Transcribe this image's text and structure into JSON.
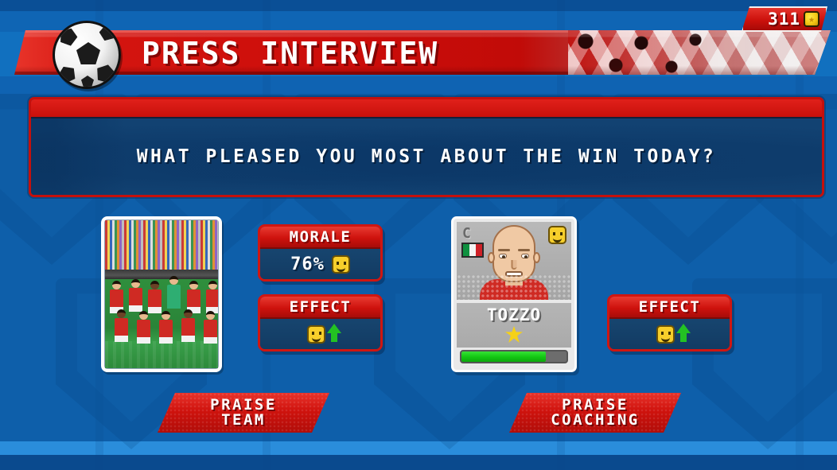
{
  "header": {
    "title": "PRESS INTERVIEW",
    "ball_icon": "soccer-ball-icon"
  },
  "currency": {
    "amount": "311",
    "icon": "coin-icon"
  },
  "question": {
    "text": "WHAT PLEASED YOU MOST ABOUT THE WIN TODAY?"
  },
  "team_option": {
    "photo_alt": "team-squad-photo",
    "morale": {
      "label": "MORALE",
      "value": "76%",
      "mood_icon": "smiley-face-icon"
    },
    "effect": {
      "label": "EFFECT",
      "mood_icon": "smiley-face-icon",
      "trend_icon": "green-up-arrow-icon"
    },
    "button_line1": "PRAISE",
    "button_line2": "TEAM"
  },
  "coach_option": {
    "player_card": {
      "captain_letter": "C",
      "nationality_flag": "italy-flag-icon",
      "mood_icon": "smiley-face-icon",
      "name": "TOZZO",
      "star_icon": "gold-star-icon",
      "rating_bar_percent": 80
    },
    "effect": {
      "label": "EFFECT",
      "mood_icon": "smiley-face-icon",
      "trend_icon": "green-up-arrow-icon"
    },
    "button_line1": "PRAISE",
    "button_line2": "COACHING"
  },
  "colors": {
    "brand_red": "#cf120d",
    "panel_navy": "#143f6d",
    "background_blue": "#0e5faa",
    "accent_yellow": "#f7cf2b",
    "positive_green": "#23c223"
  }
}
